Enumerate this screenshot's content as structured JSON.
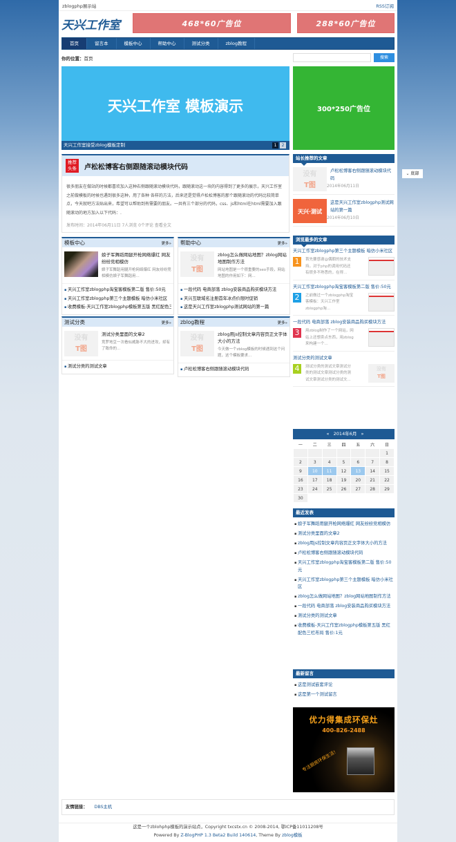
{
  "topbar": {
    "site_name": "zblogphp展示站",
    "rss": "RSS订阅"
  },
  "header": {
    "logo": "天兴工作室",
    "ad1": "468*60广告位",
    "ad2": "288*60广告位"
  },
  "nav": [
    "首页",
    "留言本",
    "模板中心",
    "帮助中心",
    "测试分类",
    "zblog教程"
  ],
  "breadcrumb": {
    "label": "你的位置：",
    "current": "首页"
  },
  "search": {
    "placeholder": "",
    "button": "搜索"
  },
  "banner": {
    "title": "天兴工作室 模板演示",
    "caption": "天兴工作室接受zblog模板定制",
    "pages": [
      "1",
      "2"
    ]
  },
  "green_ad": "300*250广告位",
  "headline": {
    "tag": "推荐头条",
    "title": "卢松松博客右侧跟随滚动模块代码",
    "excerpt": "很多朋友在做站的时候都喜欢加入这种右侧跟随滚动模块代码，跟随滚动这一块的内容得到了更多的展示，天兴工作室之前做模板的时候也遇到很多这种，用了各种 各样的方法，后来还是觉得卢松松博客的那个跟随滚动的代码比较简单点，今天就吧方法贴出来，希望可以帮助到有需要的朋友。一共有三个部分的代码，css、js和html在html需要加入跟随滚动的地方加入以下代码：.",
    "meta": "发布时间：2014年06月11日  7人浏览  0个评论  查看全文"
  },
  "boxes": [
    {
      "title": "模板中心",
      "more": "更多»",
      "feat_title": "娘子军舞蹈用腿开枪网络爆红 网友纷纷竞相模仿",
      "feat_desc": "娘子军舞蹈用腿开枪网络爆红 网友纷纷竞相模仿娘子军舞蹈用...",
      "thumb": "photo",
      "items": [
        "天兴工作室zblogphp淘宝客模板第二版 售价:50元",
        "天兴工作室zblogphp第三个主题模板 暗仿小米社区",
        "收费模板-天兴工作室zblogphp模板第五版 黑红配色三栏布局"
      ]
    },
    {
      "title": "帮助中心",
      "more": "更多»",
      "feat_title": "zblog怎么做网站地图？zblog网站地图制作方法",
      "feat_desc": "网站地图是一个很重要的seo手段，网站地图的作用如下：网...",
      "thumb": "none",
      "items": [
        "一段代码 电商部落 zblog安装商品购买模块方法",
        "天兴互联域名注册首年冰点价限时促销",
        "这是天兴工作室zblogphp测试网站的第一篇"
      ]
    },
    {
      "title": "测试分类",
      "more": "更多»",
      "feat_title": "测试分类里面的文章2",
      "feat_desc": "竞罗地豆一次看似威胁不大的进攻，却有了致命的...",
      "thumb": "none",
      "items": [
        "测试分类的测试文章"
      ]
    },
    {
      "title": "zblog教程",
      "more": "更多»",
      "feat_title": "zblog用js控制文章内容页正文字体大小的方法",
      "feat_desc": "今天做一个zblog模板的时候遇到这个问题，这个模板要求...",
      "thumb": "none",
      "items": [
        "卢松松博客右侧跟随滚动模块代码"
      ]
    }
  ],
  "no_image": {
    "line1": "没有",
    "line2": "T图"
  },
  "recommended": {
    "title": "站长推荐的文章",
    "items": [
      {
        "title": "卢松松博客右侧跟随滚动模块代码",
        "date": "2014年06月11日",
        "thumb": "none"
      },
      {
        "title": "这是天兴工作室zblogphp测试网站的第一篇",
        "date": "2014年06月10日",
        "thumb": "orange",
        "thumb_text": "天兴·测试"
      }
    ]
  },
  "most_viewed": {
    "title": "浏览最多的文章",
    "items": [
      {
        "num": "1",
        "color": "#f7931e",
        "title": "天兴工作室zblogphp第三个主题模板 暗仿小米社区",
        "desc": "首先要感谢@偶朝的技术支持，对于php的调用代码还有很多不熟悉的，在得...",
        "shot": true
      },
      {
        "num": "2",
        "color": "#1ea0e6",
        "title": "天兴工作室zblogphp淘宝客模板第二版 售价:50元",
        "desc": "之前做过一个zblogphp淘宝客模板：天兴工作室zblogphp淘...",
        "shot": true
      },
      {
        "num": "3",
        "color": "#e0344e",
        "title": "一段代码 电商部落 zblog安装商品购买模块方法",
        "desc": "用zblog制作了一个网站，网站上还想卖点东西，用zblog来构建一个...",
        "shot": true
      },
      {
        "num": "4",
        "color": "#a8d020",
        "title": "测试分类的测试文章",
        "desc": "测试分类的测试文章测试分类的测试文章测试分类的测试文章测试分类的测试文...",
        "shot": false
      }
    ]
  },
  "calendar": {
    "title": "2014年6月",
    "prev": "«",
    "next": "»",
    "weekdays": [
      "一",
      "二",
      "三",
      "四",
      "五",
      "六",
      "日"
    ],
    "first_weekday": 7,
    "days": 30,
    "highlighted": [
      10,
      11,
      13
    ]
  },
  "recent": {
    "title": "最近发表",
    "items": [
      "娘子军舞蹈用腿开枪网络爆红 网友纷纷竞相模仿",
      "测试分类里面的文章2",
      "zblog用js控制文章内容页正文字体大小的方法",
      "卢松松博客右侧跟随滚动模块代码",
      "天兴工作室zblogphp淘宝客模板第二版 售价:50元",
      "天兴工作室zblogphp第三个主题模板 暗仿小米社区",
      "zblog怎么做网站地图？zblog网站地图制作方法",
      "一段代码 电商部落 zblog安装商品购买模块方法",
      "测试分类的测试文章",
      "收费模板-天兴工作室zblogphp模板第五版 黑红配色三栏布局 售价:1元"
    ]
  },
  "comments": {
    "title": "最新留言",
    "items": [
      "这是测试嵌套评论",
      "这是第一个测试留言"
    ]
  },
  "side_ad": {
    "line1": "优力得集成环保灶",
    "line2": "400-826-2488",
    "slogan": "专注厨房环保生活!"
  },
  "float_button": "底部",
  "links": {
    "label": "友情链接：",
    "items": [
      "DBS主机"
    ]
  },
  "footer": {
    "copyright": "这是一个zblohphp模板的演示站点，Copyright txcstx.cn © 2008-2014, 鄂ICP备11011208号",
    "powered_prefix": "Powered By ",
    "powered_link": "Z-BlogPHP 1.3 Beta2 Build 140614",
    "theme_prefix": ", Theme By ",
    "theme_link": "zblog模板"
  }
}
